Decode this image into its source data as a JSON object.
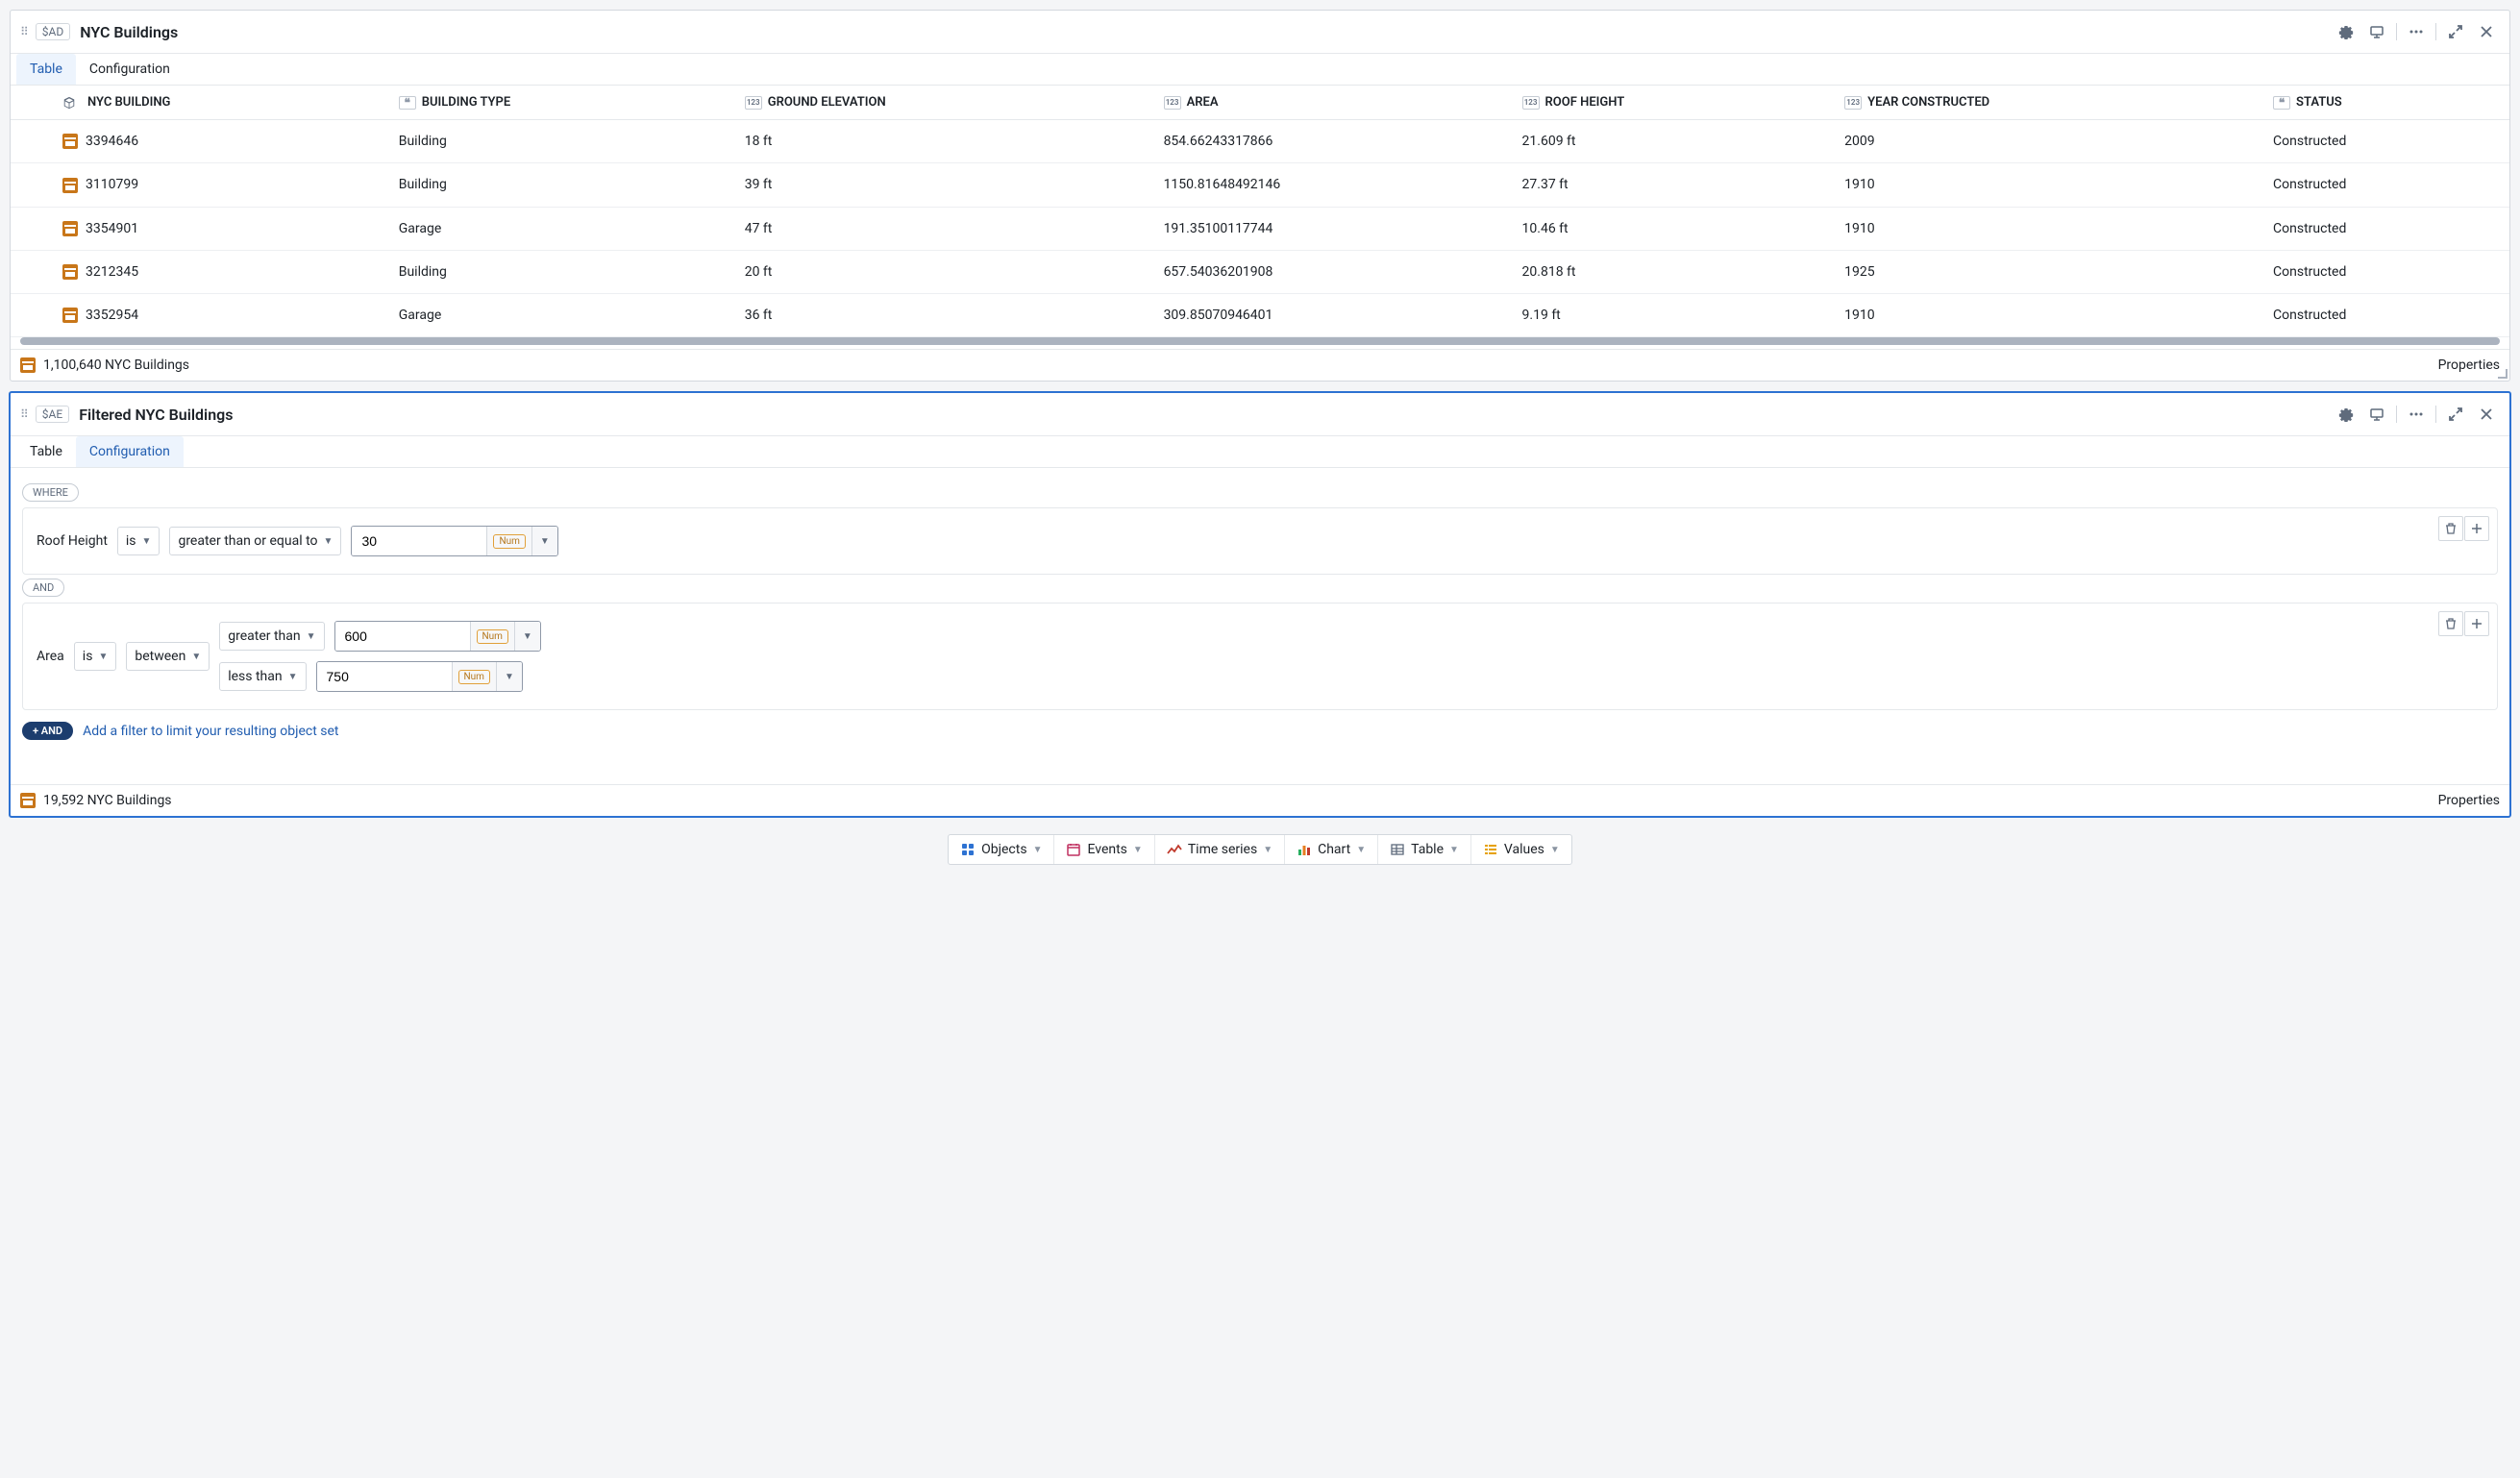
{
  "panel1": {
    "var": "$AD",
    "title": "NYC Buildings",
    "tabs": {
      "table": "Table",
      "configuration": "Configuration"
    },
    "columns": {
      "nyc_building": "NYC BUILDING",
      "building_type": "BUILDING TYPE",
      "ground_elevation": "GROUND ELEVATION",
      "area": "AREA",
      "roof_height": "ROOF HEIGHT",
      "year_constructed": "YEAR CONSTRUCTED",
      "status": "STATUS"
    },
    "rows": [
      {
        "id": "3394646",
        "type": "Building",
        "elev": "18 ft",
        "area": "854.66243317866",
        "roof": "21.609 ft",
        "year": "2009",
        "status": "Constructed"
      },
      {
        "id": "3110799",
        "type": "Building",
        "elev": "39 ft",
        "area": "1150.81648492146",
        "roof": "27.37 ft",
        "year": "1910",
        "status": "Constructed"
      },
      {
        "id": "3354901",
        "type": "Garage",
        "elev": "47 ft",
        "area": "191.35100117744",
        "roof": "10.46 ft",
        "year": "1910",
        "status": "Constructed"
      },
      {
        "id": "3212345",
        "type": "Building",
        "elev": "20 ft",
        "area": "657.54036201908",
        "roof": "20.818 ft",
        "year": "1925",
        "status": "Constructed"
      },
      {
        "id": "3352954",
        "type": "Garage",
        "elev": "36 ft",
        "area": "309.85070946401",
        "roof": "9.19 ft",
        "year": "1910",
        "status": "Constructed"
      }
    ],
    "footer_count": "1,100,640 NYC Buildings",
    "properties_label": "Properties"
  },
  "panel2": {
    "var": "$AE",
    "title": "Filtered NYC Buildings",
    "tabs": {
      "table": "Table",
      "configuration": "Configuration"
    },
    "where_label": "WHERE",
    "and_label": "AND",
    "plus_and_label": "+ AND",
    "add_filter_text": "Add a filter to limit your resulting object set",
    "filter1": {
      "field": "Roof Height",
      "is": "is",
      "op": "greater than or equal to",
      "value": "30",
      "num": "Num"
    },
    "filter2": {
      "field": "Area",
      "is": "is",
      "between": "between",
      "gt_label": "greater than",
      "gt_value": "600",
      "lt_label": "less than",
      "lt_value": "750",
      "num": "Num"
    },
    "footer_count": "19,592 NYC Buildings",
    "properties_label": "Properties"
  },
  "toolbar": {
    "objects": "Objects",
    "events": "Events",
    "timeseries": "Time series",
    "chart": "Chart",
    "table": "Table",
    "values": "Values"
  }
}
